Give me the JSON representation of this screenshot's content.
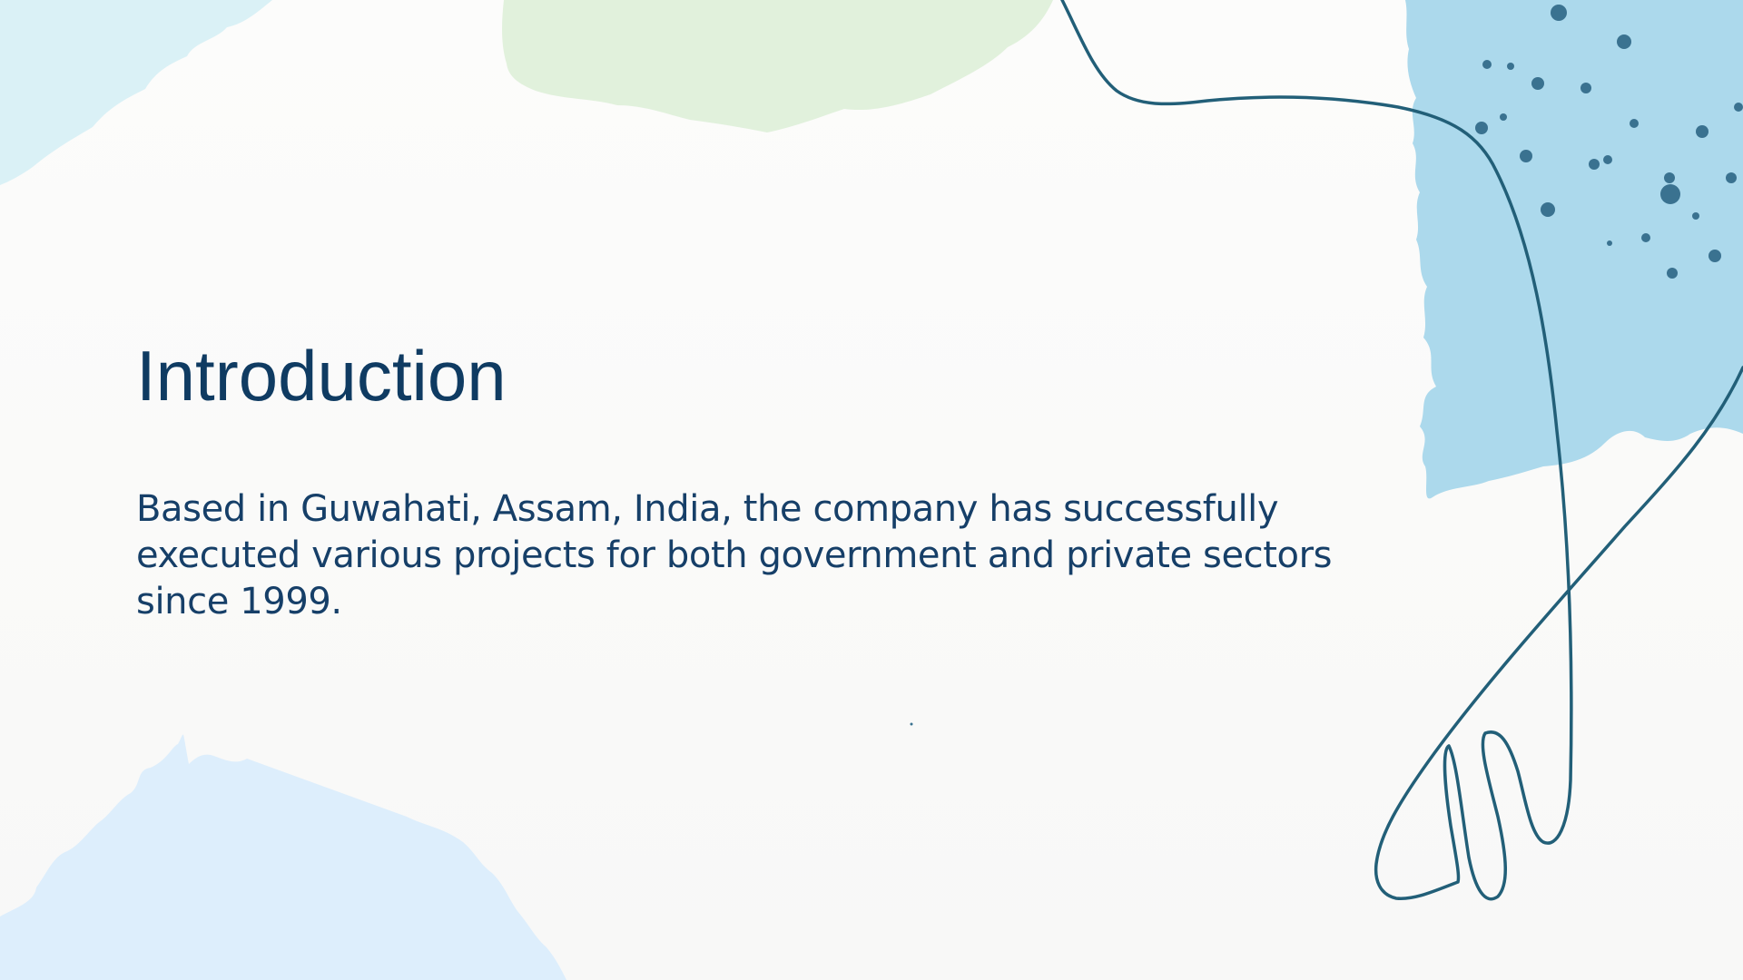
{
  "slide": {
    "title": "Introduction",
    "body": "Based in Guwahati, Assam, India,  the company has successfully executed various projects for both government and private sectors since 1999."
  },
  "colors": {
    "title_text": "#0f3b62",
    "body_text": "#163f68",
    "line_art": "#225f78",
    "splash_blue": "#acd9ec",
    "splash_green": "#dcefd6",
    "splash_cyan": "#d4eef4",
    "splash_light_blue": "#ddeefc",
    "dots": "#3a7290"
  }
}
